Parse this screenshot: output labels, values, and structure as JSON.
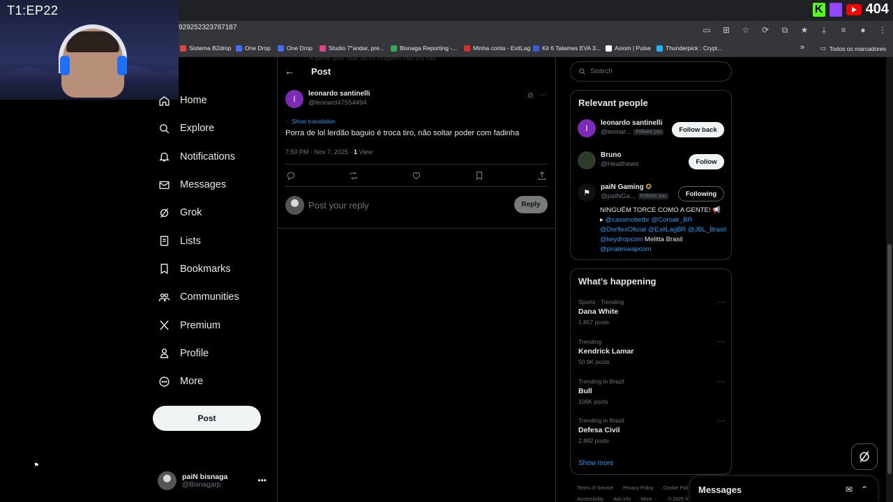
{
  "overlay": {
    "episode": "T1:EP22",
    "counter": "404"
  },
  "browser": {
    "url": "929252323787187",
    "bookmarks": [
      {
        "label": "Sistema B2drop",
        "color": "#e04545"
      },
      {
        "label": "One Drop",
        "color": "#4a6cf7"
      },
      {
        "label": "One Drop",
        "color": "#4a6cf7"
      },
      {
        "label": "Studio 7°andar, pre...",
        "color": "#e83e8c"
      },
      {
        "label": "Bisnaga Reporting -...",
        "color": "#34a853"
      },
      {
        "label": "Minha conta - ExitLag",
        "color": "#d93025"
      },
      {
        "label": "Kit 6 Tatames EVA 3...",
        "color": "#3b5bdb"
      },
      {
        "label": "Axiom | Pulse",
        "color": "#ffffff"
      },
      {
        "label": "Thunderpick : Crypt...",
        "color": "#1fb6ff"
      }
    ],
    "bookmarks_folder": "Todos os marcadores"
  },
  "nav": {
    "items": [
      {
        "label": "Home",
        "icon": "home-icon"
      },
      {
        "label": "Explore",
        "icon": "search-icon"
      },
      {
        "label": "Notifications",
        "icon": "bell-icon"
      },
      {
        "label": "Messages",
        "icon": "mail-icon"
      },
      {
        "label": "Grok",
        "icon": "grok-icon"
      },
      {
        "label": "Lists",
        "icon": "list-icon"
      },
      {
        "label": "Bookmarks",
        "icon": "bookmark-icon"
      },
      {
        "label": "Communities",
        "icon": "communities-icon"
      },
      {
        "label": "Premium",
        "icon": "x-icon"
      },
      {
        "label": "Profile",
        "icon": "person-icon"
      },
      {
        "label": "More",
        "icon": "more-circle-icon"
      }
    ],
    "post_label": "Post"
  },
  "account": {
    "name": "paiN bisnaga",
    "handle": "@Bisnagarp"
  },
  "post": {
    "header_title": "Post",
    "faded_text": "A gente quer falar do lol ninguém nda ura lolè",
    "author_name": "leonardo santinelli",
    "author_handle": "@leonard47554494",
    "author_initial": "l",
    "show_translation": "Show translation",
    "text": "Porra de lol lerdão baguio é troca tiro, não soltar poder com fadinha",
    "time": "7:50 PM · Nov 7, 2025 · ",
    "views_count": "1",
    "views_label": " View",
    "reply_placeholder": "Post your reply",
    "reply_button": "Reply"
  },
  "search": {
    "placeholder": "Search"
  },
  "relevant_people": {
    "title": "Relevant people",
    "people": [
      {
        "name": "leonardo santinelli",
        "handle": "@leonar...",
        "follows_you": "Follows you",
        "button": "Follow back"
      },
      {
        "name": "Bruno",
        "handle": "@Healthewo",
        "button": "Follow"
      },
      {
        "name": "paiN Gaming",
        "handle": "@paiNGa...",
        "follows_you": "Follows you",
        "button": "Following"
      }
    ],
    "bio": {
      "line1": "NINGUÉM TORCE COMO A GENTE! 📢",
      "arrow": "▸ ",
      "links1": "@cassinobetbr @Corsair_BR",
      "links2": "@DorflexOficial @ExitLagBR @JBL_Brasil",
      "links3": "@keydropcom",
      "plain3": " Melitta Brasil",
      "links4": "@pirateswapcom"
    }
  },
  "trends": {
    "title": "What’s happening",
    "items": [
      {
        "category": "Sports · Trending",
        "name": "Dana White",
        "count": "1,857 posts"
      },
      {
        "category": "Trending",
        "name": "Kendrick Lamar",
        "count": "50.9K posts"
      },
      {
        "category": "Trending in Brazil",
        "name": "Bull",
        "count": "106K posts"
      },
      {
        "category": "Trending in Brazil",
        "name": "Defesa Civil",
        "count": "2,882 posts"
      }
    ],
    "show_more": "Show more"
  },
  "footer": {
    "links": [
      "Terms of Service",
      "Privacy Policy",
      "Cookie Poli"
    ],
    "links2": [
      "Accessibility",
      "Ads info",
      "More ···",
      "© 2025 X"
    ]
  },
  "messages_drawer": {
    "title": "Messages"
  },
  "colors": {
    "accent": "#1d9bf0",
    "background": "#000000",
    "border": "#2f3336",
    "muted": "#71767b"
  }
}
